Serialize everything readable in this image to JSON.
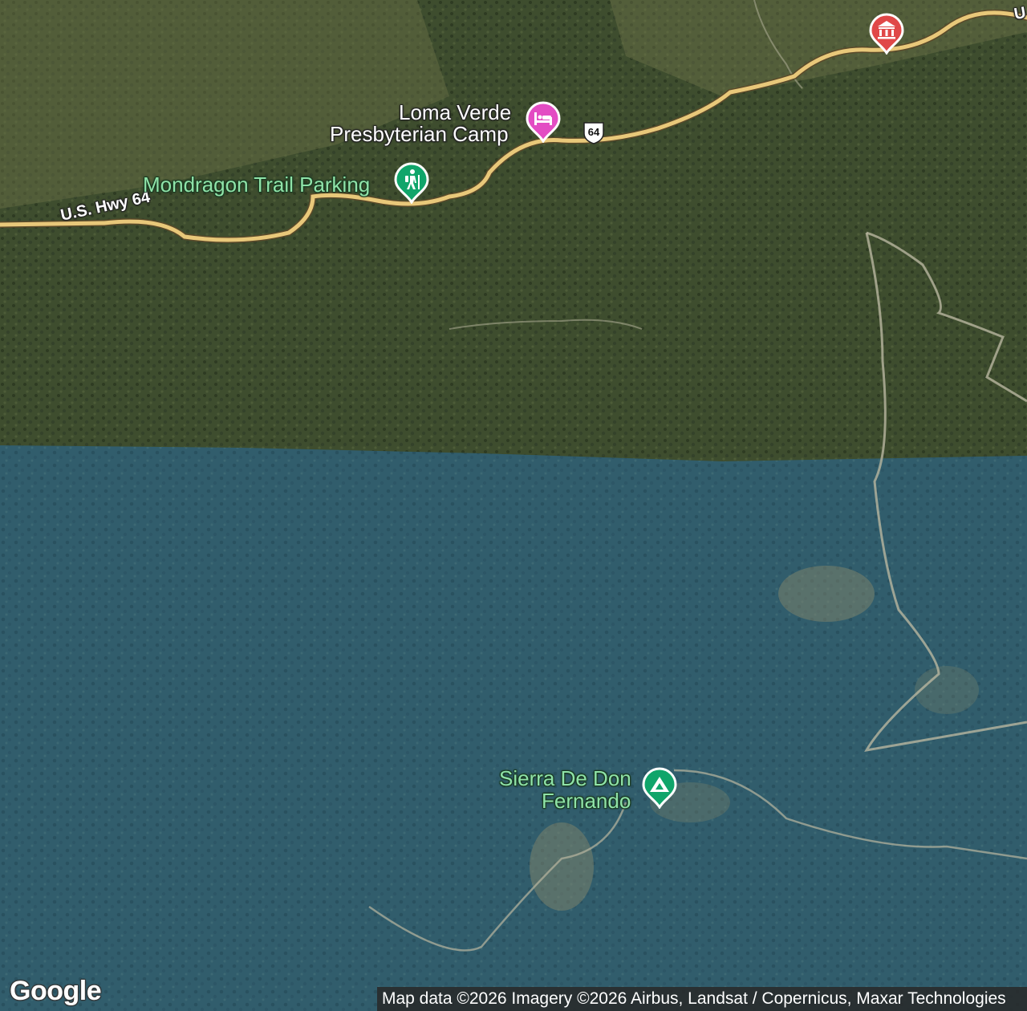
{
  "map": {
    "type": "satellite",
    "colors": {
      "forest": "#3b4a2c",
      "shaded_region": "#2f5a68",
      "road": "#e8c87a",
      "poi_green": "#10a56a",
      "poi_pink": "#e34cc3",
      "poi_red": "#e04848"
    }
  },
  "roads": {
    "hwy_label": "U.S. Hwy 64",
    "hwy_label_partial": "U",
    "shield_number": "64"
  },
  "pois": [
    {
      "id": "trail-parking",
      "name": "Mondragon Trail Parking",
      "icon": "hiker-icon",
      "color": "#10a56a"
    },
    {
      "id": "camp",
      "name_line1": "Loma Verde",
      "name_line2": "Presbyterian Camp",
      "icon": "bed-icon",
      "color": "#e34cc3"
    },
    {
      "id": "museum",
      "name": "",
      "icon": "museum-icon",
      "color": "#e04848"
    },
    {
      "id": "peak",
      "name_line1": "Sierra De Don",
      "name_line2": "Fernando",
      "icon": "mountain-icon",
      "color": "#10a56a"
    }
  ],
  "branding": {
    "logo": "Google",
    "attribution": "Map data ©2026 Imagery ©2026 Airbus, Landsat / Copernicus, Maxar Technologies"
  }
}
